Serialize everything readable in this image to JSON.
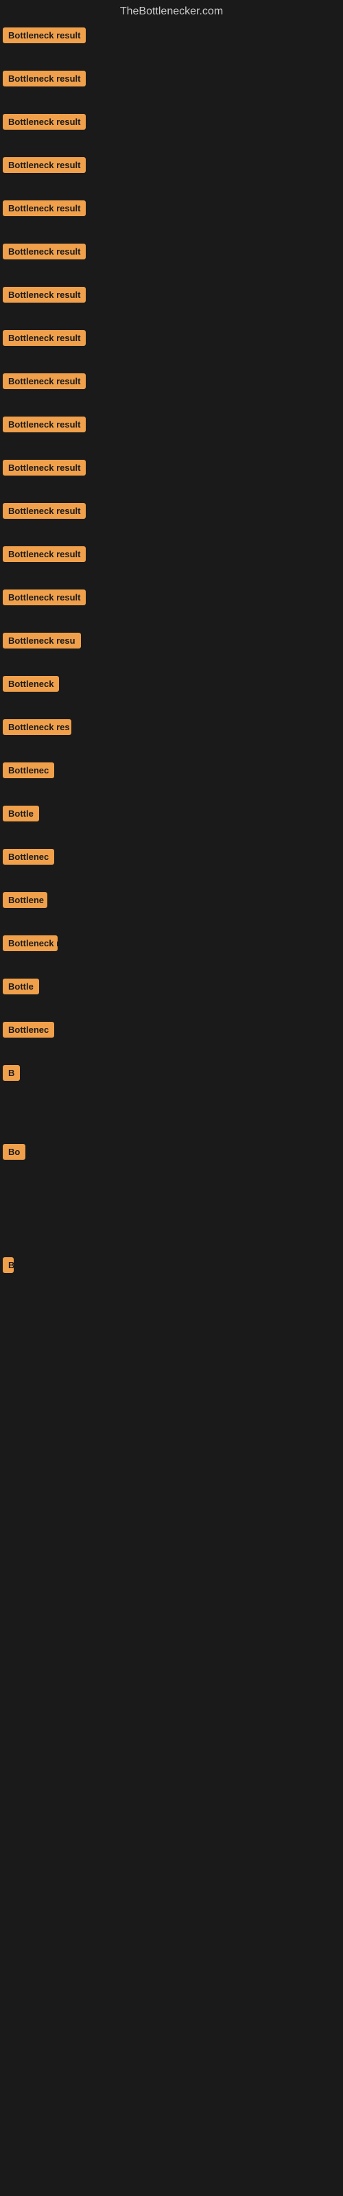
{
  "site": {
    "title": "TheBottlenecker.com"
  },
  "rows": [
    {
      "id": 0,
      "label": "Bottleneck result",
      "spacer": 28
    },
    {
      "id": 1,
      "label": "Bottleneck result",
      "spacer": 28
    },
    {
      "id": 2,
      "label": "Bottleneck result",
      "spacer": 28
    },
    {
      "id": 3,
      "label": "Bottleneck result",
      "spacer": 28
    },
    {
      "id": 4,
      "label": "Bottleneck result",
      "spacer": 28
    },
    {
      "id": 5,
      "label": "Bottleneck result",
      "spacer": 28
    },
    {
      "id": 6,
      "label": "Bottleneck result",
      "spacer": 28
    },
    {
      "id": 7,
      "label": "Bottleneck result",
      "spacer": 28
    },
    {
      "id": 8,
      "label": "Bottleneck result",
      "spacer": 28
    },
    {
      "id": 9,
      "label": "Bottleneck result",
      "spacer": 28
    },
    {
      "id": 10,
      "label": "Bottleneck result",
      "spacer": 28
    },
    {
      "id": 11,
      "label": "Bottleneck result",
      "spacer": 28
    },
    {
      "id": 12,
      "label": "Bottleneck result",
      "spacer": 28
    },
    {
      "id": 13,
      "label": "Bottleneck result",
      "spacer": 28
    },
    {
      "id": 14,
      "label": "Bottleneck resu",
      "spacer": 28
    },
    {
      "id": 15,
      "label": "Bottleneck",
      "spacer": 28
    },
    {
      "id": 16,
      "label": "Bottleneck res",
      "spacer": 28
    },
    {
      "id": 17,
      "label": "Bottlenec",
      "spacer": 28
    },
    {
      "id": 18,
      "label": "Bottle",
      "spacer": 28
    },
    {
      "id": 19,
      "label": "Bottlenec",
      "spacer": 28
    },
    {
      "id": 20,
      "label": "Bottlene",
      "spacer": 28
    },
    {
      "id": 21,
      "label": "Bottleneck r",
      "spacer": 28
    },
    {
      "id": 22,
      "label": "Bottle",
      "spacer": 28
    },
    {
      "id": 23,
      "label": "Bottlenec",
      "spacer": 28
    },
    {
      "id": 24,
      "label": "B",
      "spacer": 80
    },
    {
      "id": 25,
      "label": "Bo",
      "spacer": 130
    },
    {
      "id": 26,
      "label": "B",
      "spacer": 160
    }
  ]
}
